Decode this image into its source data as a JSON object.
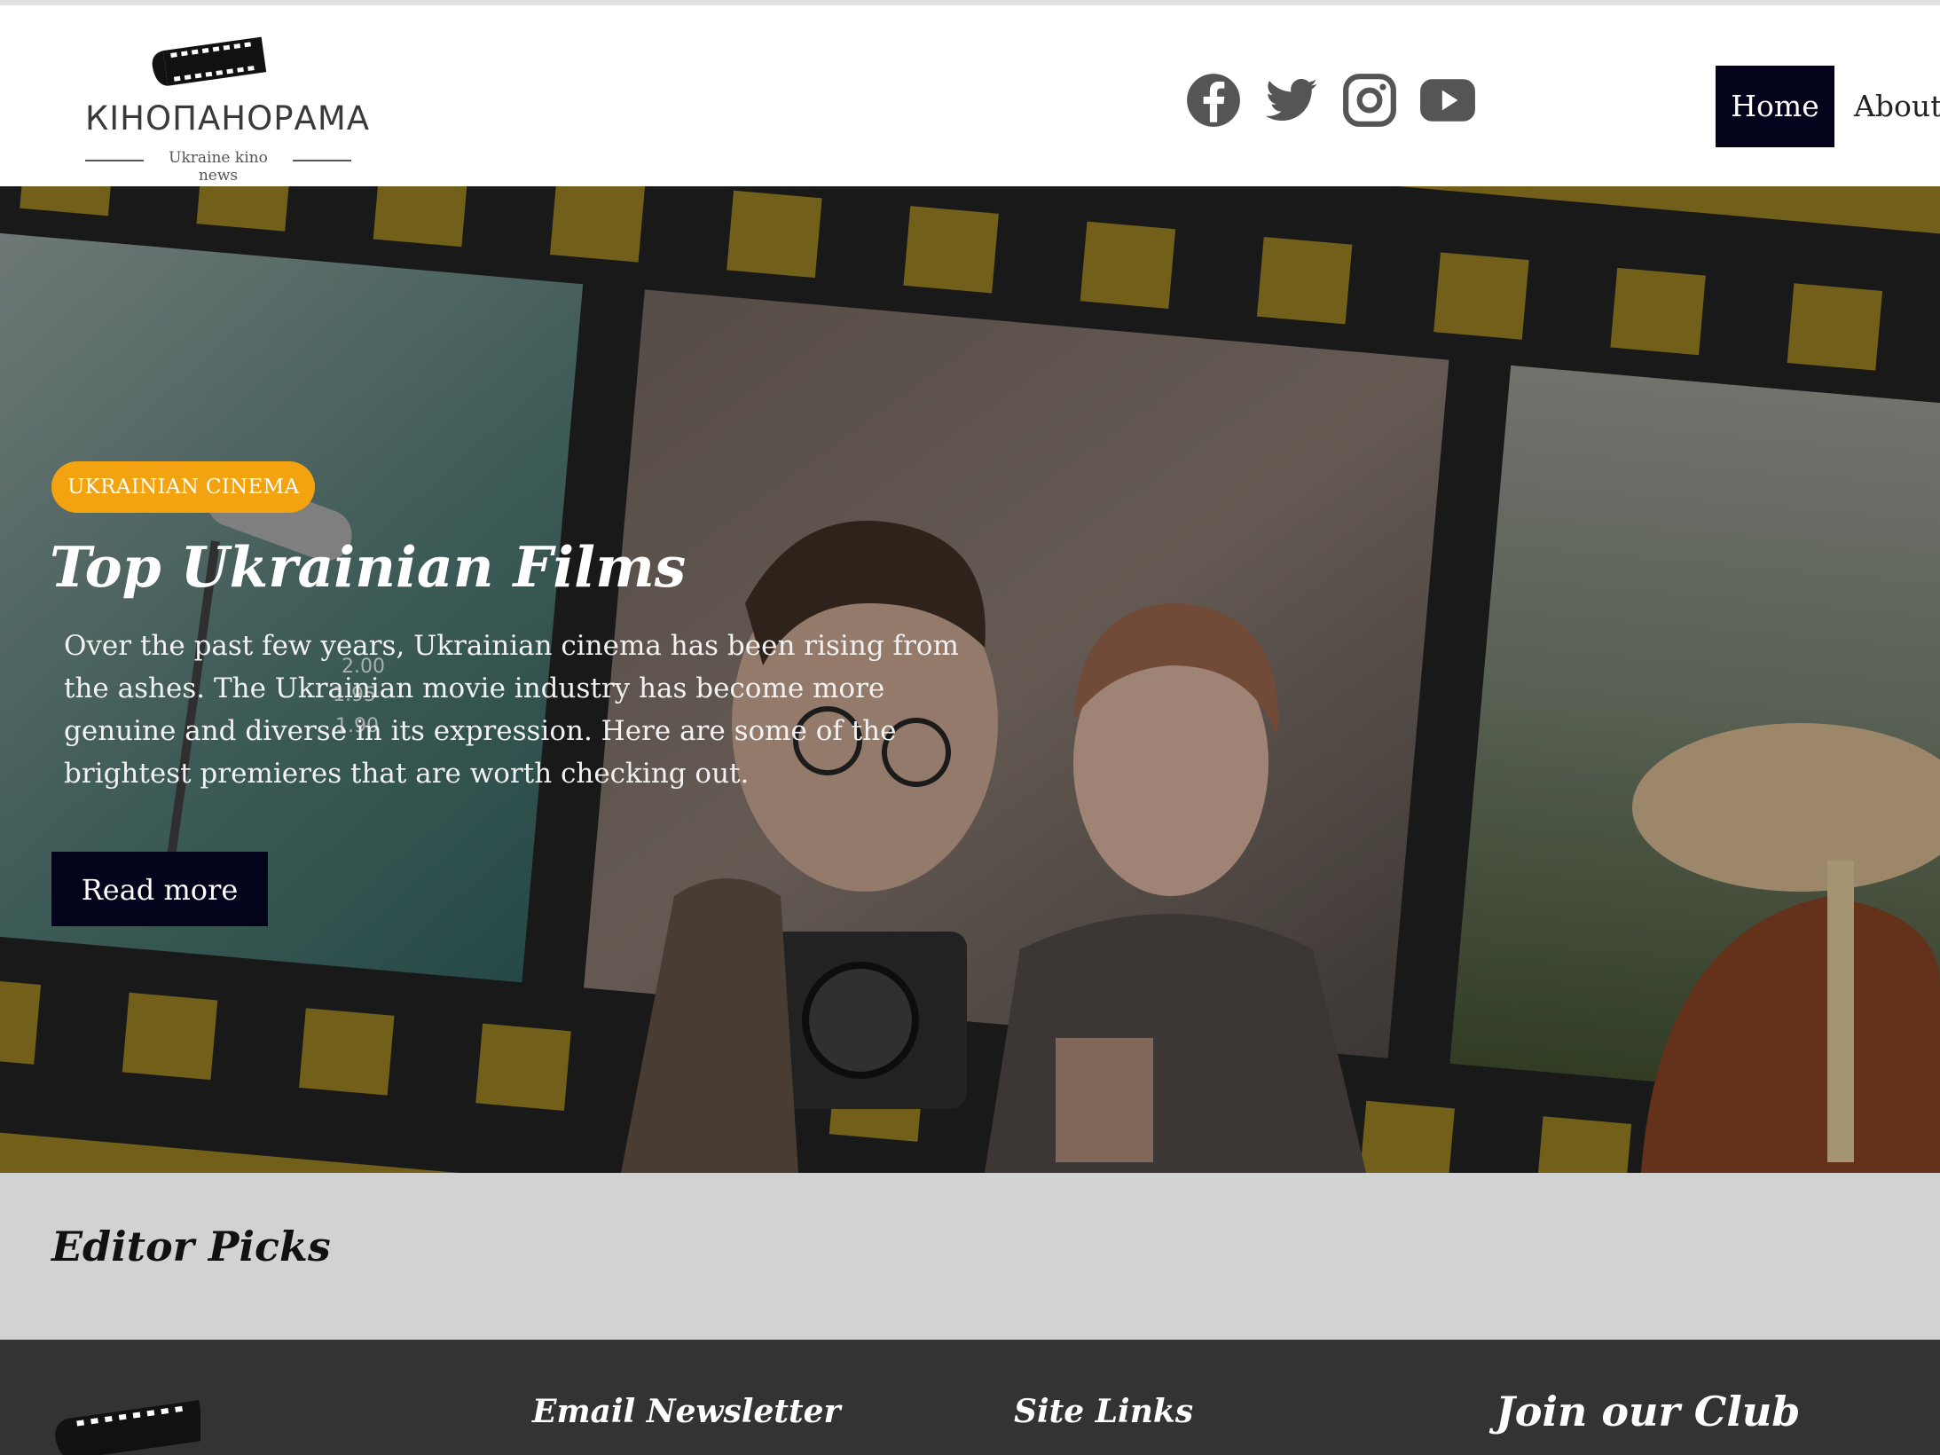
{
  "header": {
    "logo_title": "КІНОПАНОРАМА",
    "logo_tagline": "Ukraine kino news",
    "socials": [
      {
        "icon": "facebook-icon"
      },
      {
        "icon": "twitter-icon"
      },
      {
        "icon": "instagram-icon"
      },
      {
        "icon": "youtube-icon"
      }
    ],
    "nav": {
      "home": "Home",
      "about": "About"
    }
  },
  "hero": {
    "badge": "UKRAINIAN CINEMA",
    "title": "Top Ukrainian Films",
    "description": "Over the past few years, Ukrainian cinema has been rising from the ashes. The Ukrainian movie industry has become more genuine and diverse in its expression. Here are some of the brightest premieres that are worth checking out.",
    "button": "Read more"
  },
  "editor_picks": {
    "title": "Editor Picks"
  },
  "footer": {
    "newsletter_title": "Email Newsletter",
    "links_title": "Site Links",
    "club_title": "Join our Club"
  },
  "colors": {
    "nav_active_bg": "#03031c",
    "badge_bg": "#f2a30f",
    "film_strip": "#1f1f1f",
    "film_holes": "#8a7420",
    "picks_bg": "#d2d2d2",
    "footer_bg": "#333333"
  }
}
